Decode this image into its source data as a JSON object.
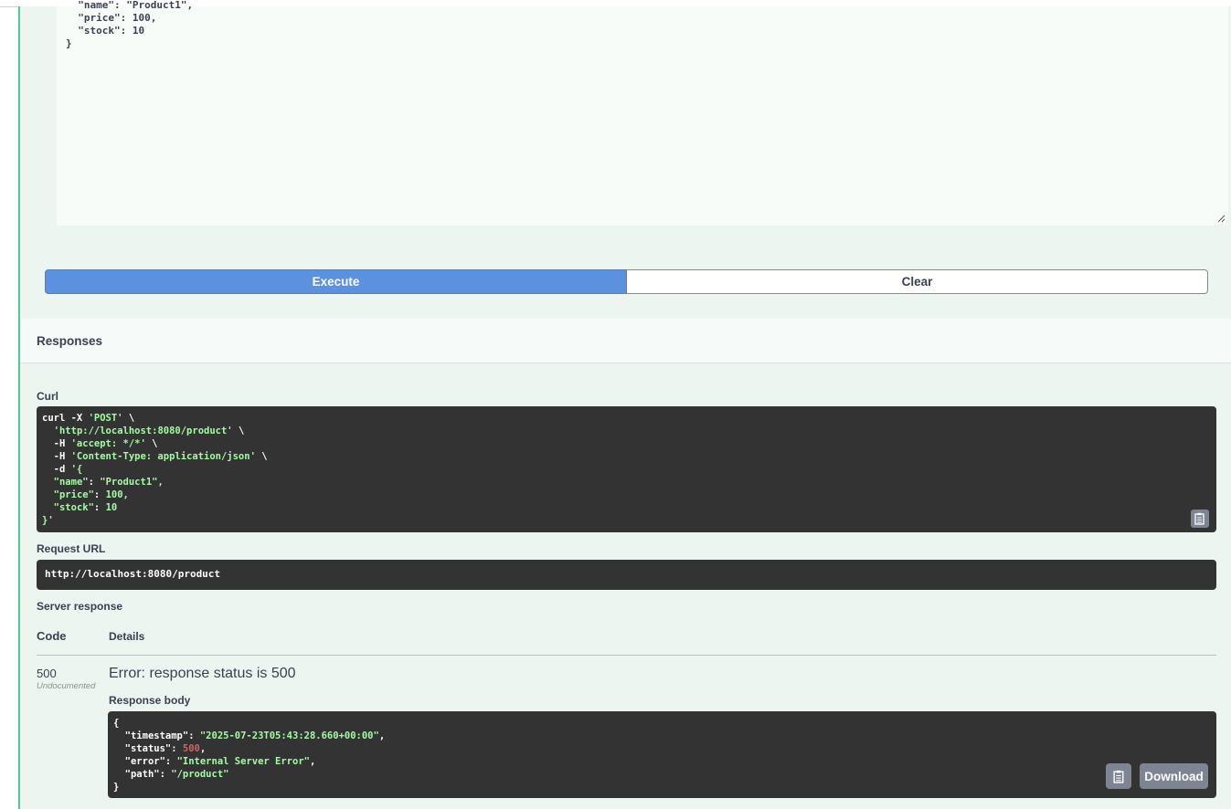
{
  "request_body": {
    "lines": [
      "  \"name\": \"Product1\",",
      "  \"price\": 100,",
      "  \"stock\": 10",
      "}"
    ]
  },
  "buttons": {
    "execute": "Execute",
    "clear": "Clear"
  },
  "responses": {
    "title": "Responses",
    "curl_label": "Curl",
    "curl": {
      "line1_cmd": "curl -X ",
      "line1_method": "'POST'",
      "line1_tail": " \\",
      "line2_url": "'http://localhost:8080/product'",
      "line2_tail": " \\",
      "line3_flag": "  -H ",
      "line3_val": "'accept: */*'",
      "line3_tail": " \\",
      "line4_flag": "  -H ",
      "line4_val": "'Content-Type: application/json'",
      "line4_tail": " \\",
      "line5_flag": "  -d ",
      "line5_val": "'{",
      "line6_key": "\"name\"",
      "line6_val": "\"Product1\"",
      "line7_key": "\"price\"",
      "line7_val": "100",
      "line8_key": "\"stock\"",
      "line8_val": "10",
      "line9": "}'"
    },
    "request_url_label": "Request URL",
    "request_url": "http://localhost:8080/product",
    "server_response_label": "Server response",
    "col_code": "Code",
    "col_details": "Details",
    "code": "500",
    "undocumented": "Undocumented",
    "error_message": "Error: response status is 500",
    "response_body_label": "Response body",
    "body": {
      "open": "{",
      "timestamp_key": "\"timestamp\"",
      "timestamp_val": "\"2025-07-23T05:43:28.660+00:00\"",
      "status_key": "\"status\"",
      "status_val": "500",
      "error_key": "\"error\"",
      "error_val": "\"Internal Server Error\"",
      "path_key": "\"path\"",
      "path_val": "\"/product\"",
      "close": "}"
    },
    "download_label": "Download"
  }
}
